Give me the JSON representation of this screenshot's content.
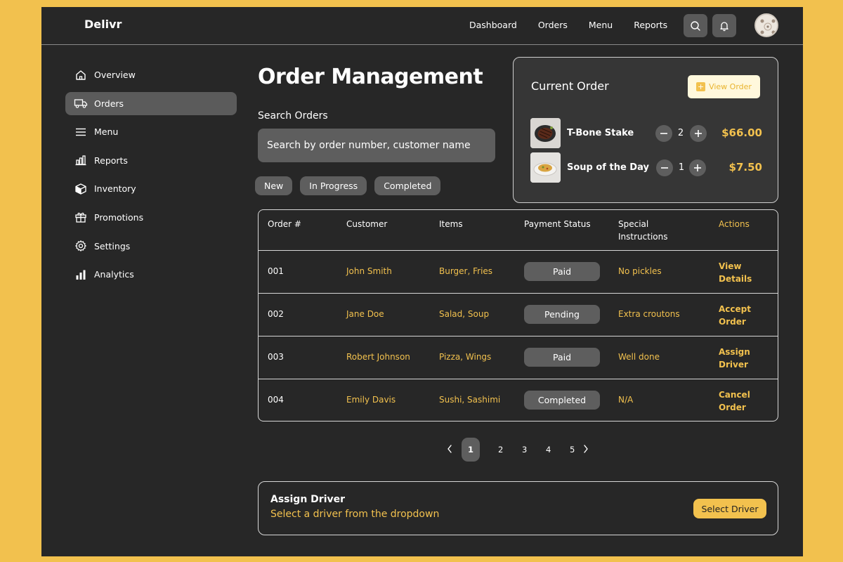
{
  "app": {
    "brand": "Delivr"
  },
  "topnav": {
    "items": [
      "Dashboard",
      "Orders",
      "Menu",
      "Reports"
    ],
    "search_icon": "search-icon",
    "bell_icon": "bell-icon"
  },
  "sidebar": {
    "items": [
      {
        "label": "Overview",
        "icon": "home-icon"
      },
      {
        "label": "Orders",
        "icon": "truck-icon",
        "active": true
      },
      {
        "label": "Menu",
        "icon": "menu-icon"
      },
      {
        "label": "Reports",
        "icon": "bar-chart-icon"
      },
      {
        "label": "Inventory",
        "icon": "box-icon"
      },
      {
        "label": "Promotions",
        "icon": "gift-icon"
      },
      {
        "label": "Settings",
        "icon": "gear-icon"
      },
      {
        "label": "Analytics",
        "icon": "analytics-icon"
      }
    ]
  },
  "main": {
    "title": "Order Management",
    "search_label": "Search Orders",
    "search_placeholder": "Search  by order number, customer name",
    "filters": [
      "New",
      "In Progress",
      "Completed"
    ]
  },
  "current_order": {
    "title": "Current Order",
    "view_order_label": "View Order",
    "items": [
      {
        "name": "T-Bone Stake",
        "qty": "2",
        "price": "$66.00"
      },
      {
        "name": "Soup of the Day",
        "qty": "1",
        "price": "$7.50"
      }
    ]
  },
  "table": {
    "headers": {
      "order": "Order #",
      "customer": "Customer",
      "items": "Items",
      "payment": "Payment Status",
      "special_1": "Special",
      "special_2": "Instructions",
      "actions": "Actions"
    },
    "rows": [
      {
        "order": "001",
        "customer": "John Smith",
        "items": "Burger, Fries",
        "payment": "Paid",
        "special": "No pickles",
        "action_1": "View",
        "action_2": "Details"
      },
      {
        "order": "002",
        "customer": "Jane Doe",
        "items": "Salad, Soup",
        "payment": "Pending",
        "special": "Extra croutons",
        "action_1": "Accept",
        "action_2": "Order"
      },
      {
        "order": "003",
        "customer": "Robert Johnson",
        "items": "Pizza, Wings",
        "payment": "Paid",
        "special": "Well done",
        "action_1": "Assign",
        "action_2": "Driver"
      },
      {
        "order": "004",
        "customer": "Emily Davis",
        "items": "Sushi, Sashimi",
        "payment": "Completed",
        "special": "N/A",
        "action_1": "Cancel",
        "action_2": "Order"
      }
    ]
  },
  "pagination": {
    "pages": [
      "1",
      "2",
      "3",
      "4",
      "5"
    ],
    "current": "1"
  },
  "assign_driver": {
    "title": "Assign Driver",
    "subtitle": "Select a driver from the dropdown",
    "button_label": "Select Driver"
  },
  "colors": {
    "accent": "#f2c14e",
    "background": "#272727",
    "surface": "#5e5e5e",
    "outer": "#f2c14e"
  }
}
